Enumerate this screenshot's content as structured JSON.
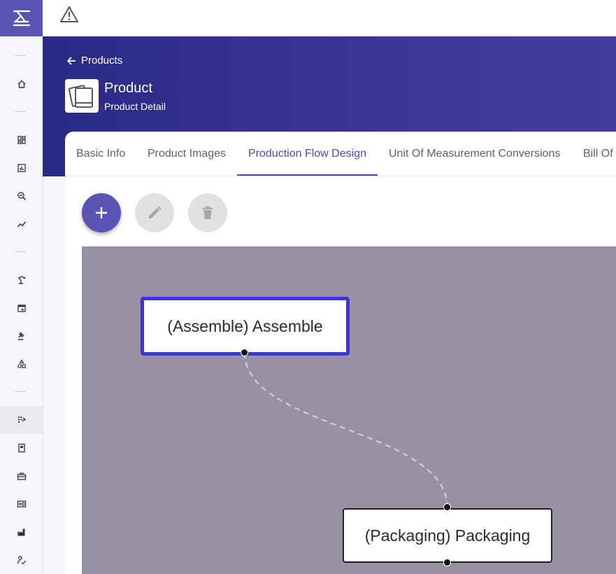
{
  "header": {
    "back_label": "Products",
    "title": "Product",
    "subtitle": "Product Detail"
  },
  "tabs": [
    {
      "label": "Basic Info",
      "active": false
    },
    {
      "label": "Product Images",
      "active": false
    },
    {
      "label": "Production Flow Design",
      "active": true
    },
    {
      "label": "Unit Of Measurement Conversions",
      "active": false
    },
    {
      "label": "Bill Of",
      "active": false
    }
  ],
  "toolbar": {
    "add_icon": "plus-icon",
    "edit_icon": "pencil-icon",
    "delete_icon": "trash-icon"
  },
  "flow": {
    "nodes": [
      {
        "label": "(Assemble) Assemble",
        "selected": true
      },
      {
        "label": "(Packaging) Packaging",
        "selected": false
      }
    ],
    "edges": [
      {
        "from": "(Assemble) Assemble",
        "to": "(Packaging) Packaging",
        "style": "dashed"
      }
    ]
  },
  "colors": {
    "primary": "#5a55b4",
    "band": "#2f2c8c",
    "canvas": "#9891a3",
    "selected_border": "#3b33e0"
  },
  "sidebar": {
    "icons": [
      "home-icon",
      "dashboard-icon",
      "chart-icon",
      "analytics-icon",
      "trend-icon",
      "robot-arm-icon",
      "calendar-icon",
      "gavel-icon",
      "shapes-icon",
      "grid-check-icon",
      "document-icon",
      "toolbox-icon",
      "hd-icon",
      "factory-icon",
      "signature-icon"
    ]
  }
}
